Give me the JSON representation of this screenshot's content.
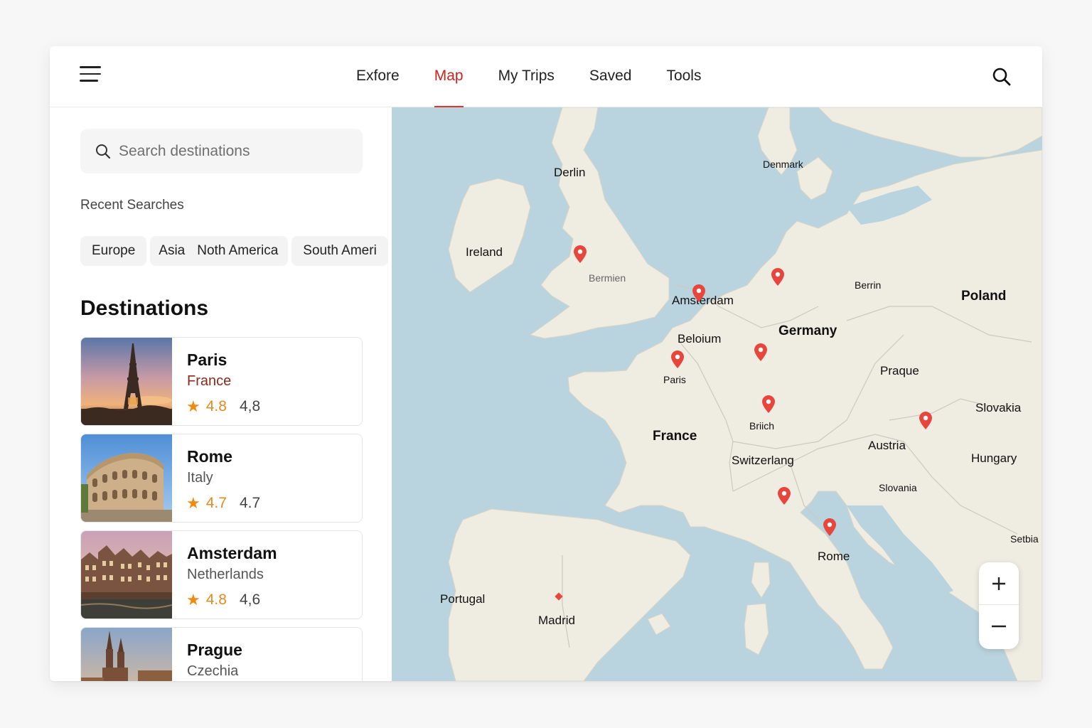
{
  "header": {
    "tabs": [
      {
        "label": "Exfore",
        "active": false
      },
      {
        "label": "Map",
        "active": true
      },
      {
        "label": "My Trips",
        "active": false
      },
      {
        "label": "Saved",
        "active": false
      },
      {
        "label": "Tools",
        "active": false
      }
    ],
    "menu_icon": "hamburger-menu-icon",
    "search_icon": "search-icon",
    "accent_color": "#e0342c"
  },
  "sidebar": {
    "search": {
      "placeholder": "Search destinations",
      "value": ""
    },
    "recent_title": "Recent Searches",
    "recent_chips": [
      "Europe",
      "Asia",
      "Noth America",
      "South Ameri"
    ],
    "destinations_title": "Destinations",
    "destinations": [
      {
        "name": "Paris",
        "country": "France",
        "rating": "4.8",
        "reviews": "4,8",
        "image": "eiffel-tower-sunset"
      },
      {
        "name": "Rome",
        "country": "Italy",
        "rating": "4.7",
        "reviews": "4.7",
        "image": "colosseum"
      },
      {
        "name": "Amsterdam",
        "country": "Netherlands",
        "rating": "4.8",
        "reviews": "4,6",
        "image": "canal-houses"
      },
      {
        "name": "Prague",
        "country": "Czechia",
        "rating": "",
        "reviews": "",
        "image": "prague-church-spires"
      }
    ]
  },
  "map": {
    "labels": {
      "derlin": "Derlin",
      "denmark": "Denmark",
      "ireland": "Ireland",
      "bermien": "Bermien",
      "amsterdam": "Amsterdam",
      "berrin": "Berrin",
      "poland": "Poland",
      "germany": "Germany",
      "beloium": "Beloium",
      "paris": "Paris",
      "praque": "Praque",
      "slovakia": "Slovakia",
      "briich": "Briich",
      "france": "France",
      "austria": "Austria",
      "switzerlang": "Switzerlang",
      "hungary": "Hungary",
      "slovania": "Slovania",
      "setbia": "Setbia",
      "rome": "Rome",
      "portugal": "Portugal",
      "madrid": "Madrid"
    },
    "pin_color": "#e8453c",
    "zoom_in_icon": "plus-icon",
    "zoom_out_icon": "minus-icon"
  }
}
